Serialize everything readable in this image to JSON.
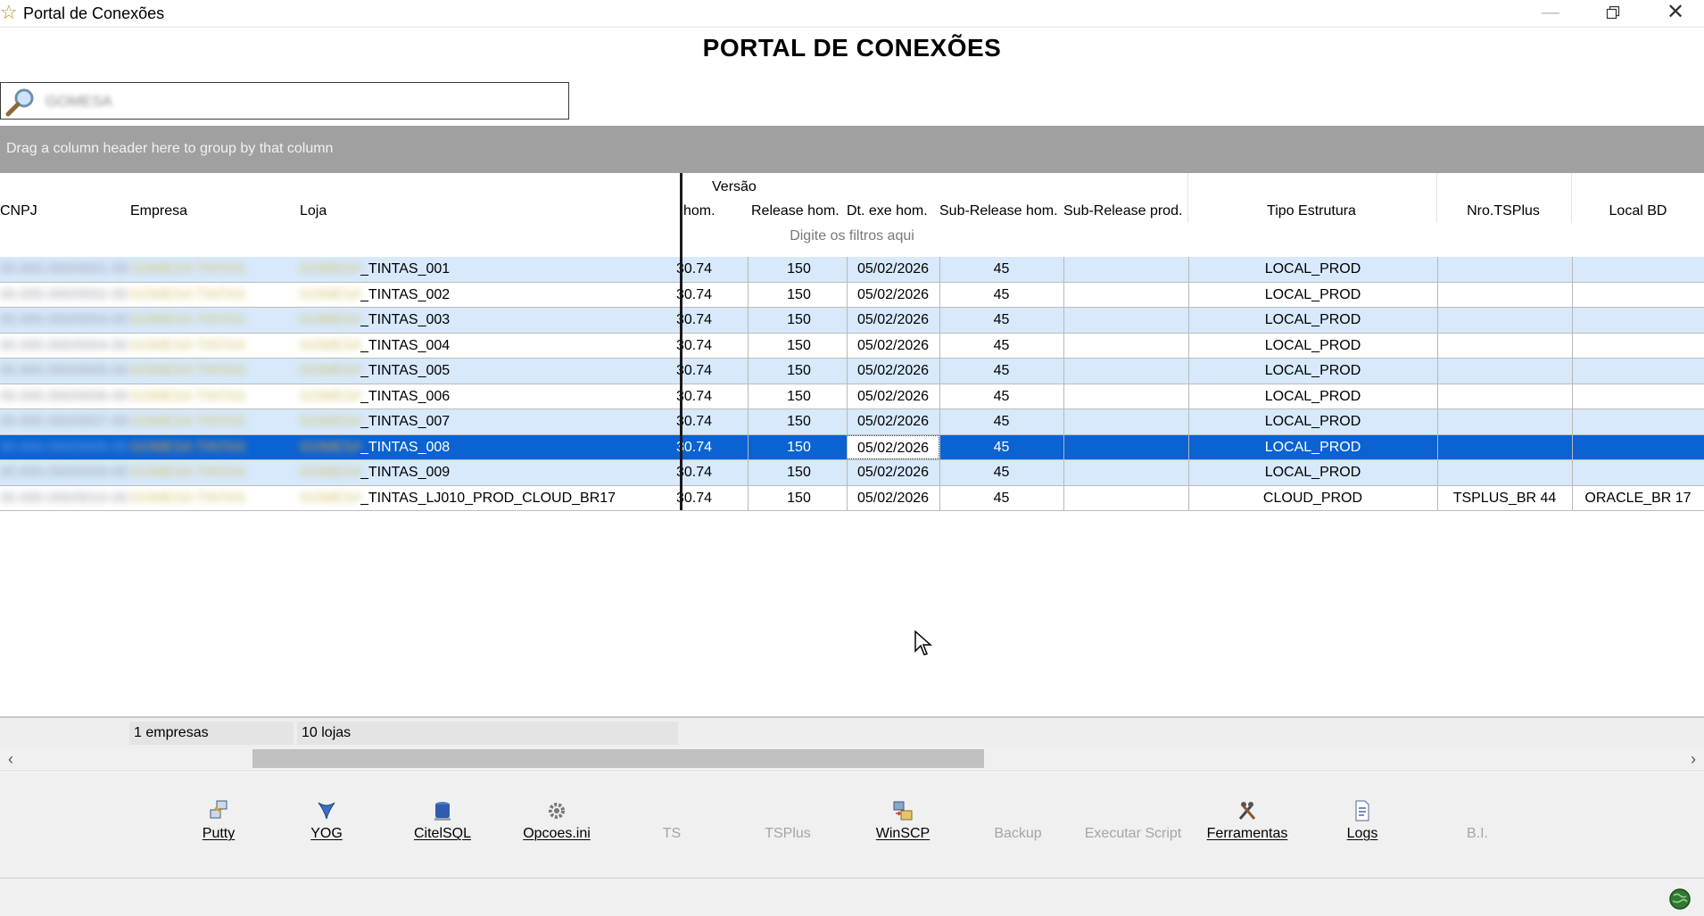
{
  "window": {
    "title": "Portal de Conexões",
    "icon": "star-icon"
  },
  "page_title": "PORTAL DE CONEXÕES",
  "search": {
    "value": "GOMESA",
    "icon": "magnifier-icon"
  },
  "group_panel": {
    "hint": "Drag a column header here to group by that column"
  },
  "grid": {
    "band_label": "Versão",
    "columns": [
      "CNPJ",
      "Empresa",
      "Loja",
      "hom.",
      "Release hom.",
      "Dt. exe hom.",
      "Sub-Release hom.",
      "Sub-Release prod.",
      "Tipo Estrutura",
      "Nro.TSPlus",
      "Local BD"
    ],
    "filter_hint": "Digite os filtros aqui",
    "rows": [
      {
        "cnpj": "00.000.000/0001-00",
        "empresa": "GOMESA TINTAS",
        "loja_prefix": "GOMESA",
        "loja": "_TINTAS_001",
        "hom": "30.74",
        "release_hom": "150",
        "dt_exe_hom": "05/02/2026",
        "sub_release_hom": "45",
        "sub_release_prod": "",
        "tipo_estrutura": "LOCAL_PROD",
        "nro_tsplus": "",
        "local_bd": ""
      },
      {
        "cnpj": "00.000.000/0002-00",
        "empresa": "GOMESA TINTAS",
        "loja_prefix": "GOMESA",
        "loja": "_TINTAS_002",
        "hom": "30.74",
        "release_hom": "150",
        "dt_exe_hom": "05/02/2026",
        "sub_release_hom": "45",
        "sub_release_prod": "",
        "tipo_estrutura": "LOCAL_PROD",
        "nro_tsplus": "",
        "local_bd": ""
      },
      {
        "cnpj": "00.000.000/0003-00",
        "empresa": "GOMESA TINTAS",
        "loja_prefix": "GOMESA",
        "loja": "_TINTAS_003",
        "hom": "30.74",
        "release_hom": "150",
        "dt_exe_hom": "05/02/2026",
        "sub_release_hom": "45",
        "sub_release_prod": "",
        "tipo_estrutura": "LOCAL_PROD",
        "nro_tsplus": "",
        "local_bd": ""
      },
      {
        "cnpj": "00.000.000/0004-00",
        "empresa": "GOMESA TINTAS",
        "loja_prefix": "GOMESA",
        "loja": "_TINTAS_004",
        "hom": "30.74",
        "release_hom": "150",
        "dt_exe_hom": "05/02/2026",
        "sub_release_hom": "45",
        "sub_release_prod": "",
        "tipo_estrutura": "LOCAL_PROD",
        "nro_tsplus": "",
        "local_bd": ""
      },
      {
        "cnpj": "00.000.000/0005-00",
        "empresa": "GOMESA TINTAS",
        "loja_prefix": "GOMESA",
        "loja": "_TINTAS_005",
        "hom": "30.74",
        "release_hom": "150",
        "dt_exe_hom": "05/02/2026",
        "sub_release_hom": "45",
        "sub_release_prod": "",
        "tipo_estrutura": "LOCAL_PROD",
        "nro_tsplus": "",
        "local_bd": ""
      },
      {
        "cnpj": "00.000.000/0006-00",
        "empresa": "GOMESA TINTAS",
        "loja_prefix": "GOMESA",
        "loja": "_TINTAS_006",
        "hom": "30.74",
        "release_hom": "150",
        "dt_exe_hom": "05/02/2026",
        "sub_release_hom": "45",
        "sub_release_prod": "",
        "tipo_estrutura": "LOCAL_PROD",
        "nro_tsplus": "",
        "local_bd": ""
      },
      {
        "cnpj": "00.000.000/0007-00",
        "empresa": "GOMESA TINTAS",
        "loja_prefix": "GOMESA",
        "loja": "_TINTAS_007",
        "hom": "30.74",
        "release_hom": "150",
        "dt_exe_hom": "05/02/2026",
        "sub_release_hom": "45",
        "sub_release_prod": "",
        "tipo_estrutura": "LOCAL_PROD",
        "nro_tsplus": "",
        "local_bd": ""
      },
      {
        "cnpj": "00.000.000/0008-00",
        "empresa": "GOMESA TINTAS",
        "loja_prefix": "GOMESA",
        "loja": "_TINTAS_008",
        "hom": "30.74",
        "release_hom": "150",
        "dt_exe_hom": "05/02/2026",
        "sub_release_hom": "45",
        "sub_release_prod": "",
        "tipo_estrutura": "LOCAL_PROD",
        "nro_tsplus": "",
        "local_bd": "",
        "selected": true
      },
      {
        "cnpj": "00.000.000/0009-00",
        "empresa": "GOMESA TINTAS",
        "loja_prefix": "GOMESA",
        "loja": "_TINTAS_009",
        "hom": "30.74",
        "release_hom": "150",
        "dt_exe_hom": "05/02/2026",
        "sub_release_hom": "45",
        "sub_release_prod": "",
        "tipo_estrutura": "LOCAL_PROD",
        "nro_tsplus": "",
        "local_bd": ""
      },
      {
        "cnpj": "00.000.000/0010-00",
        "empresa": "GOMESA TINTAS",
        "loja_prefix": "GOMESA",
        "loja": "_TINTAS_LJ010_PROD_CLOUD_BR17",
        "hom": "30.74",
        "release_hom": "150",
        "dt_exe_hom": "05/02/2026",
        "sub_release_hom": "45",
        "sub_release_prod": "",
        "tipo_estrutura": "CLOUD_PROD",
        "nro_tsplus": "TSPLUS_BR 44",
        "local_bd": "ORACLE_BR 17"
      }
    ]
  },
  "summary": {
    "empresas": "1 empresas",
    "lojas": "10 lojas"
  },
  "toolbar": {
    "items": [
      {
        "label": "Putty",
        "icon": "putty-icon",
        "enabled": true
      },
      {
        "label": "YOG",
        "icon": "yog-icon",
        "enabled": true
      },
      {
        "label": "CitelSQL",
        "icon": "database-icon",
        "enabled": true
      },
      {
        "label": "Opcoes.ini",
        "icon": "gear-icon",
        "enabled": true
      },
      {
        "label": "TS",
        "icon": "",
        "enabled": false
      },
      {
        "label": "TSPlus",
        "icon": "",
        "enabled": false
      },
      {
        "label": "WinSCP",
        "icon": "winscp-icon",
        "enabled": true
      },
      {
        "label": "Backup",
        "icon": "",
        "enabled": false
      },
      {
        "label": "Executar Script",
        "icon": "",
        "enabled": false
      },
      {
        "label": "Ferramentas",
        "icon": "tools-icon",
        "enabled": true
      },
      {
        "label": "Logs",
        "icon": "log-file-icon",
        "enabled": true
      },
      {
        "label": "B.I.",
        "icon": "",
        "enabled": false
      }
    ]
  },
  "status": {
    "icon": "globe-icon"
  },
  "colors": {
    "selected_row": "#0a63d1",
    "alt_row": "#d7e9fb",
    "group_panel": "#a0a0a0"
  }
}
